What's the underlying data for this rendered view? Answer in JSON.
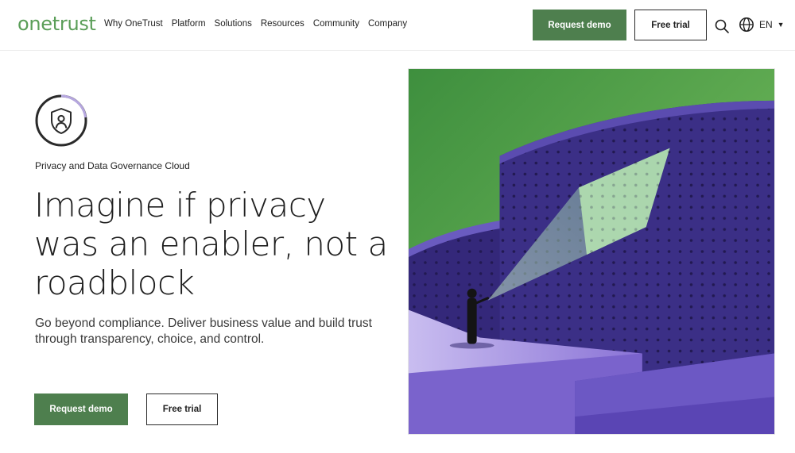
{
  "header": {
    "logo": "onetrust",
    "nav": [
      "Why OneTrust",
      "Platform",
      "Solutions",
      "Resources",
      "Community",
      "Company"
    ],
    "request_demo": "Request demo",
    "free_trial": "Free trial",
    "language": "EN"
  },
  "hero": {
    "eyebrow": "Privacy and Data Governance Cloud",
    "headline": "Imagine if privacy was an enabler, not a roadblock",
    "subtext": "Go beyond compliance. Deliver business value and build trust through transparency, choice, and control.",
    "request_demo": "Request demo",
    "free_trial": "Free trial"
  },
  "colors": {
    "brand_green": "#5a9e58",
    "button_green": "#4e7f4e",
    "illustration_purple": "#3a2f7a",
    "illustration_green": "#4c9a45"
  },
  "icons": {
    "product": "shield-user-icon",
    "search": "search-icon",
    "language": "globe-icon"
  }
}
